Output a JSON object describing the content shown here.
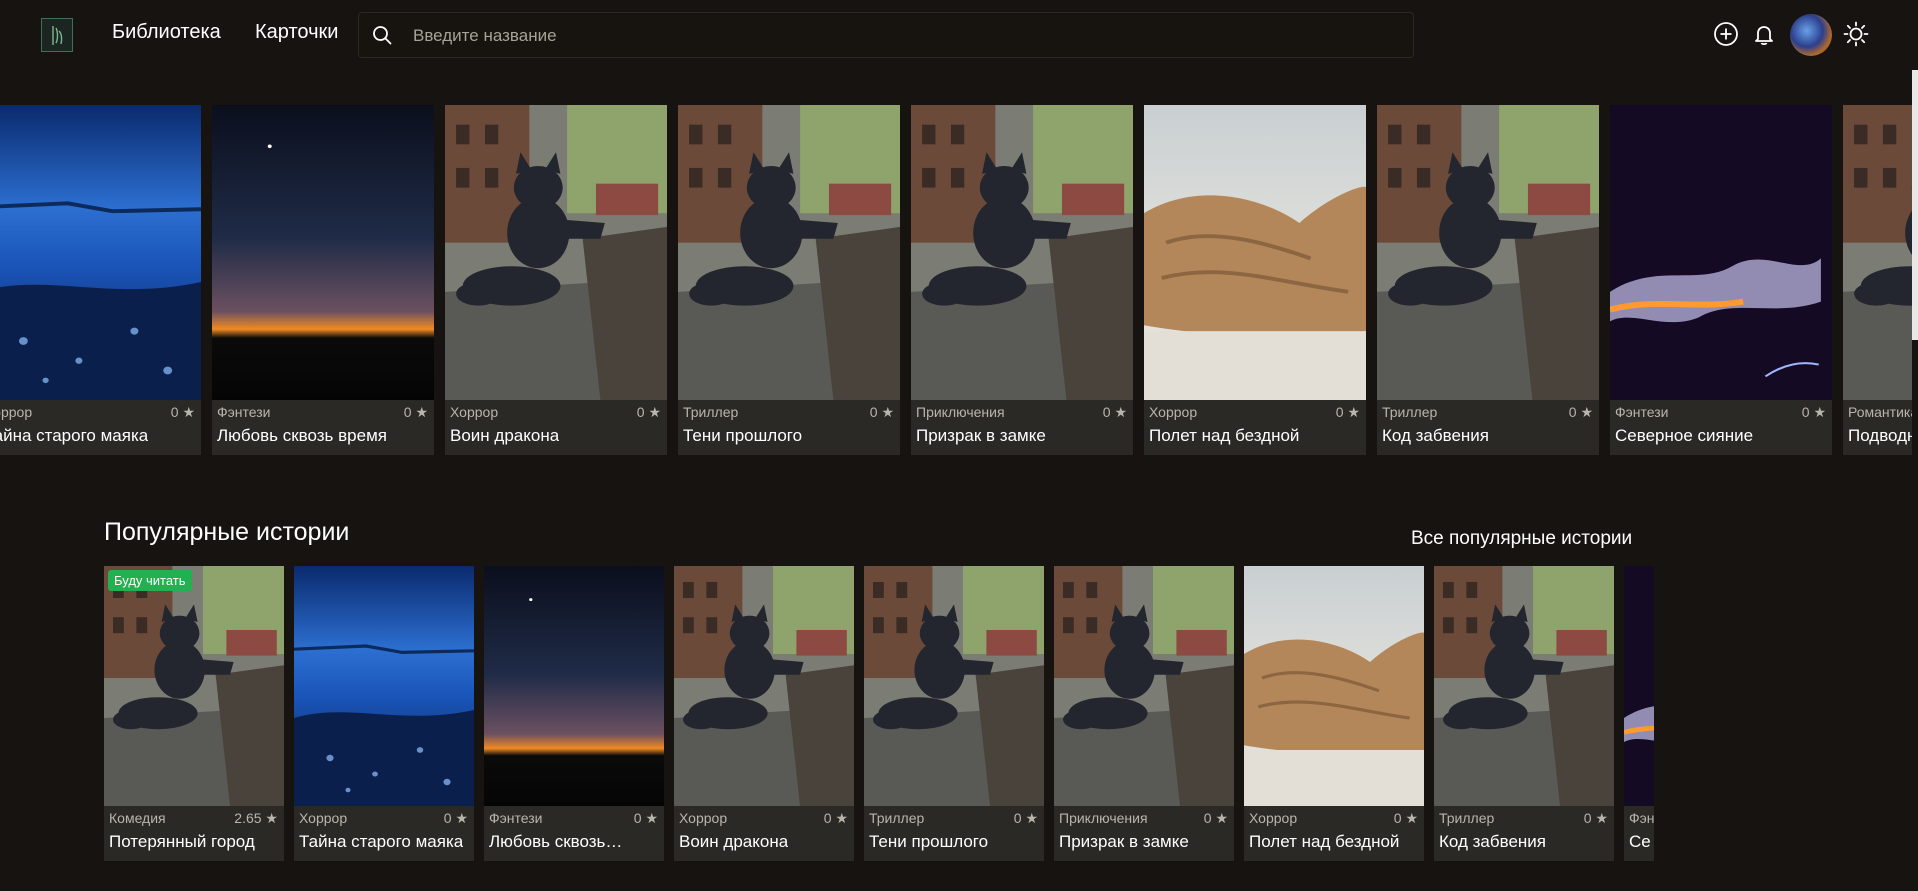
{
  "header": {
    "logo_icon": "book-logo-icon",
    "nav": [
      {
        "label": "Библиотека"
      },
      {
        "label": "Карточки"
      }
    ],
    "search": {
      "placeholder": "Введите название",
      "value": ""
    },
    "icons": [
      "plus-circle-icon",
      "bell-icon",
      "avatar",
      "sun-icon"
    ]
  },
  "featured_row": [
    {
      "genre": "Хоррор",
      "rating": "0 ★",
      "title": "Тайна старого маяка",
      "image": "blue-lake"
    },
    {
      "genre": "Фэнтези",
      "rating": "0 ★",
      "title": "Любовь сквозь время",
      "image": "sunset"
    },
    {
      "genre": "Хоррор",
      "rating": "0 ★",
      "title": "Воин дракона",
      "image": "cat-statue"
    },
    {
      "genre": "Триллер",
      "rating": "0 ★",
      "title": "Тени прошлого",
      "image": "cat-statue"
    },
    {
      "genre": "Приключения",
      "rating": "0 ★",
      "title": "Призрак в замке",
      "image": "cat-statue"
    },
    {
      "genre": "Хоррор",
      "rating": "0 ★",
      "title": "Полет над бездной",
      "image": "walrus"
    },
    {
      "genre": "Триллер",
      "rating": "0 ★",
      "title": "Код забвения",
      "image": "cat-statue"
    },
    {
      "genre": "Фэнтези",
      "rating": "0 ★",
      "title": "Северное сияние",
      "image": "smoke"
    },
    {
      "genre": "Романтика",
      "rating": "",
      "title": "Подводн",
      "image": "cat-statue"
    }
  ],
  "popular": {
    "title": "Популярные истории",
    "see_all": "Все популярные истории",
    "badge": "Буду читать",
    "items": [
      {
        "genre": "Комедия",
        "rating": "2.65 ★",
        "title": "Потерянный город",
        "image": "cat-statue"
      },
      {
        "genre": "Хоррор",
        "rating": "0 ★",
        "title": "Тайна старого маяка",
        "image": "blue-lake"
      },
      {
        "genre": "Фэнтези",
        "rating": "0 ★",
        "title": "Любовь сквозь…",
        "image": "sunset"
      },
      {
        "genre": "Хоррор",
        "rating": "0 ★",
        "title": "Воин дракона",
        "image": "cat-statue"
      },
      {
        "genre": "Триллер",
        "rating": "0 ★",
        "title": "Тени прошлого",
        "image": "cat-statue"
      },
      {
        "genre": "Приключения",
        "rating": "0 ★",
        "title": "Призрак в замке",
        "image": "cat-statue"
      },
      {
        "genre": "Хоррор",
        "rating": "0 ★",
        "title": "Полет над бездной",
        "image": "walrus"
      },
      {
        "genre": "Триллер",
        "rating": "0 ★",
        "title": "Код забвения",
        "image": "cat-statue"
      },
      {
        "genre": "Фэн",
        "rating": "",
        "title": "Се",
        "image": "smoke"
      }
    ]
  }
}
